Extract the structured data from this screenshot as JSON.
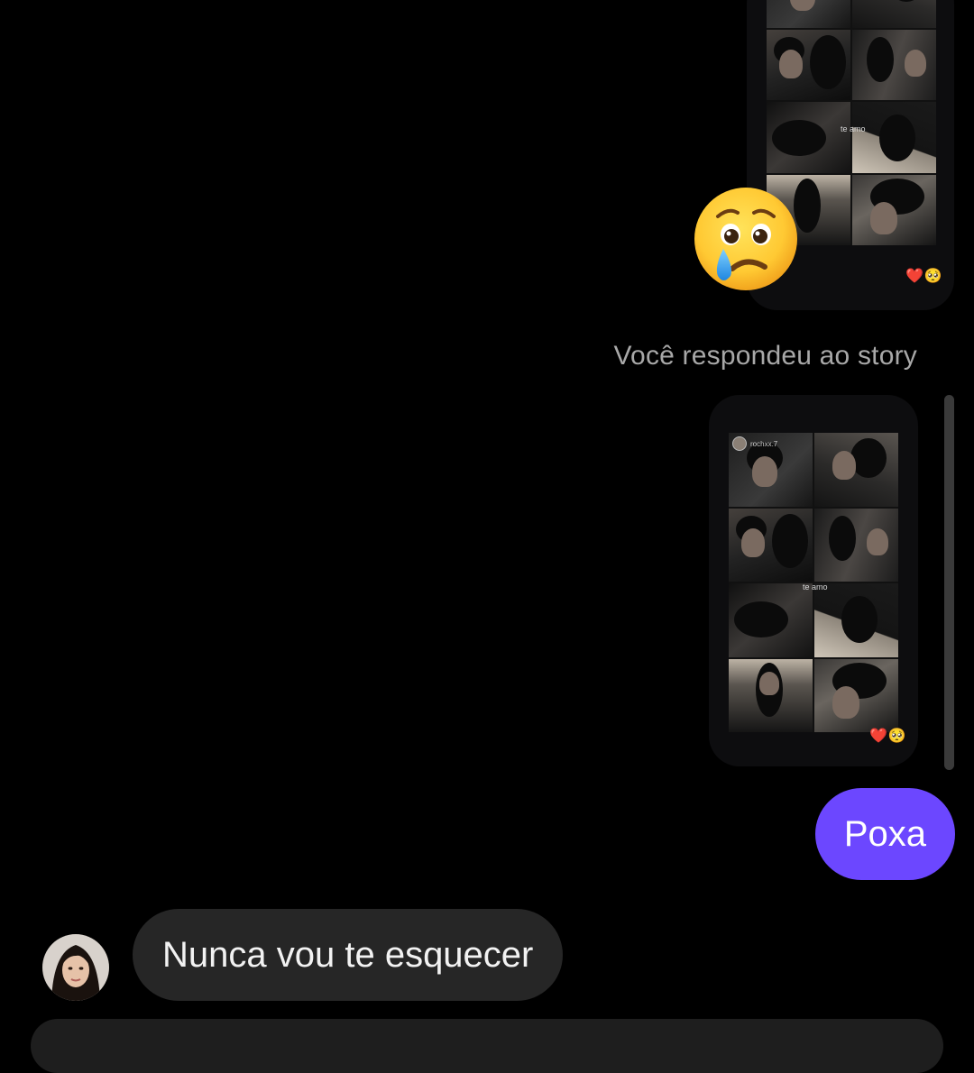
{
  "thread": {
    "first_story": {
      "caption": "te amo",
      "emoji": [
        "❤️",
        "🥺"
      ],
      "reaction_emoji": "😢"
    },
    "reply_note": "Você respondeu ao story",
    "second_story": {
      "username": "rochxx.7",
      "caption": "te amo",
      "emoji": [
        "❤️",
        "🥺"
      ]
    },
    "messages": [
      {
        "direction": "outgoing",
        "text": "Poxa"
      },
      {
        "direction": "incoming",
        "text": "Nunca vou te esquecer"
      }
    ]
  },
  "colors": {
    "outgoing_bubble": "#6c47ff",
    "incoming_bubble": "#262626",
    "background": "#000000"
  }
}
